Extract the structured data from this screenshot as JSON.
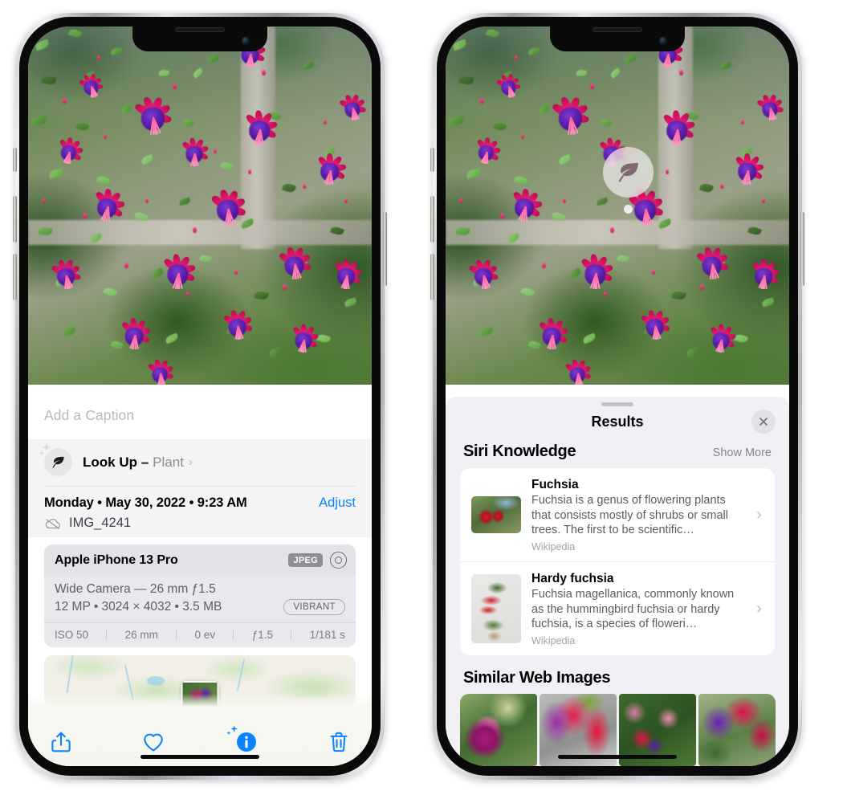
{
  "left_phone": {
    "caption": {
      "placeholder": "Add a Caption",
      "value": ""
    },
    "lookup": {
      "label": "Look Up –",
      "subject": "Plant",
      "chevron": "›",
      "icon": "leaf-icon"
    },
    "metadata": {
      "date_line": "Monday • May 30, 2022 • 9:23 AM",
      "adjust_label": "Adjust",
      "filename": "IMG_4241",
      "cloud_icon": "cloud-slash-icon"
    },
    "camera_card": {
      "model": "Apple iPhone 13 Pro",
      "format_badge": "JPEG",
      "raw_icon": "raw-aperture-icon",
      "lens": "Wide Camera — 26 mm ƒ1.5",
      "specs": "12 MP • 3024 × 4032 • 3.5 MB",
      "style_pill": "VIBRANT",
      "exif": [
        "ISO 50",
        "26 mm",
        "0 ev",
        "ƒ1.5",
        "1/181 s"
      ]
    },
    "toolbar": {
      "share_label": "share-icon",
      "favorite_label": "heart-icon",
      "info_label": "info-sparkle-icon",
      "delete_label": "trash-icon"
    }
  },
  "right_phone": {
    "visual_lookup_badge": {
      "icon": "leaf-icon"
    },
    "sheet": {
      "title": "Results",
      "close_label": "close-icon",
      "sections": [
        {
          "title": "Siri Knowledge",
          "action_label": "Show More",
          "items": [
            {
              "name": "Fuchsia",
              "description": "Fuchsia is a genus of flowering plants that consists mostly of shrubs or small trees. The first to be scientific…",
              "source": "Wikipedia",
              "chevron": "›"
            },
            {
              "name": "Hardy fuchsia",
              "description": "Fuchsia magellanica, commonly known as the hummingbird fuchsia or hardy fuchsia, is a species of floweri…",
              "source": "Wikipedia",
              "chevron": "›"
            }
          ]
        },
        {
          "title": "Similar Web Images",
          "items": [
            {
              "alt": "fuchsia-web-image-1"
            },
            {
              "alt": "fuchsia-web-image-2"
            },
            {
              "alt": "fuchsia-web-image-3"
            },
            {
              "alt": "fuchsia-web-image-4"
            }
          ]
        }
      ]
    }
  },
  "colors": {
    "accent_blue": "#0a84ff",
    "sheet_gray": "#f1f1f5",
    "card_white": "#ffffff",
    "secondary_text": "#8a8a8f",
    "badge_gray": "#8e8e93"
  }
}
